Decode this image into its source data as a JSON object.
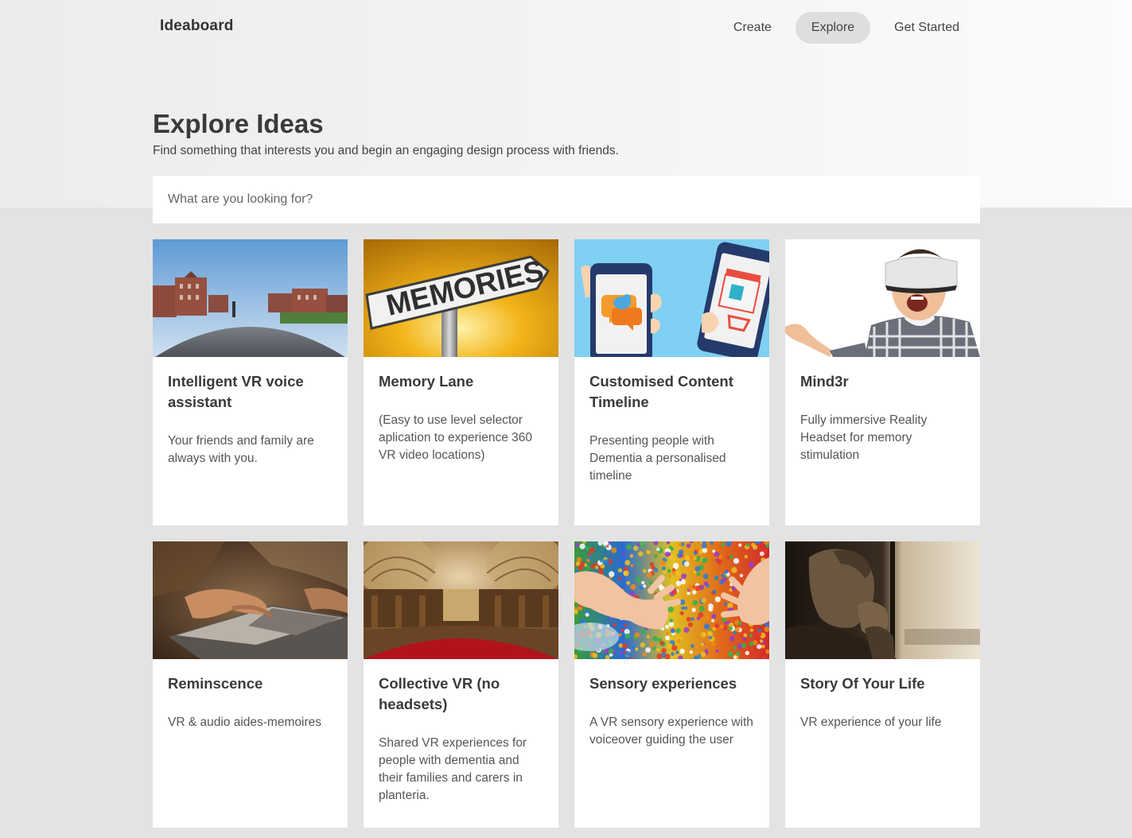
{
  "brand": {
    "name": "Ideaboard"
  },
  "nav": {
    "items": [
      {
        "label": "Create",
        "active": false
      },
      {
        "label": "Explore",
        "active": true
      },
      {
        "label": "Get Started",
        "active": false
      }
    ]
  },
  "header": {
    "title": "Explore Ideas",
    "subtitle": "Find something that interests you and begin an engaging design process with friends."
  },
  "search": {
    "placeholder": "What are you looking for?",
    "value": ""
  },
  "cards": [
    {
      "title": "Intelligent VR voice assistant",
      "description": "Your friends and family are always with you.",
      "image": "vr-panorama-campus-image"
    },
    {
      "title": "Memory Lane",
      "description": "(Easy to use level selector aplication to experience 360 VR video locations)",
      "image": "memories-signpost-image",
      "sign_text": "MEMORIES"
    },
    {
      "title": "Customised Content Timeline",
      "description": "Presenting people with Dementia a personalised timeline",
      "image": "phones-illustration-image"
    },
    {
      "title": "Mind3r",
      "description": "Fully immersive Reality Headset for memory stimulation",
      "image": "vr-headset-man-image"
    },
    {
      "title": "Reminscence",
      "description": "VR & audio aides-memoires",
      "image": "photo-album-hands-image"
    },
    {
      "title": "Collective VR (no headsets)",
      "description": "Shared VR experiences for people with dementia and their families and carers in planteria.",
      "image": "cathedral-panorama-image"
    },
    {
      "title": "Sensory experiences",
      "description": "A VR sensory experience with voiceover guiding the user",
      "image": "colorful-beads-hands-image"
    },
    {
      "title": "Story Of Your Life",
      "description": "VR experience of your life",
      "image": "elderly-man-window-image"
    }
  ],
  "colors": {
    "page_bg": "#e3e3e3",
    "card_bg": "#ffffff",
    "active_nav_bg": "#dedede",
    "text": "#333333"
  }
}
